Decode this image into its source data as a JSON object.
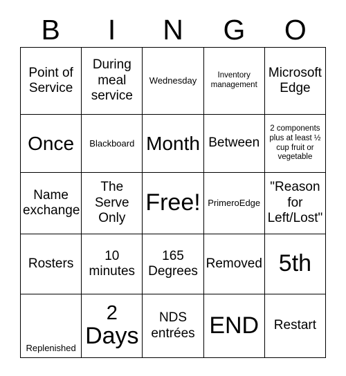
{
  "card": {
    "header_letters": [
      "B",
      "I",
      "N",
      "G",
      "O"
    ],
    "rows": [
      [
        {
          "text": "Point of Service",
          "size": "fs-md"
        },
        {
          "text": "During meal service",
          "size": "fs-md"
        },
        {
          "text": "Wednesday",
          "size": "fs-sm"
        },
        {
          "text": "Inventory management",
          "size": "fs-xs"
        },
        {
          "text": "Microsoft Edge",
          "size": "fs-md"
        }
      ],
      [
        {
          "text": "Once",
          "size": "fs-xl"
        },
        {
          "text": "Blackboard",
          "size": "fs-sm"
        },
        {
          "text": "Month",
          "size": "fs-xl"
        },
        {
          "text": "Between",
          "size": "fs-md"
        },
        {
          "text": "2 components plus at least ½ cup fruit or vegetable",
          "size": "fs-xs"
        }
      ],
      [
        {
          "text": "Name exchange",
          "size": "fs-md"
        },
        {
          "text": "The Serve Only",
          "size": "fs-md"
        },
        {
          "text": "Free!",
          "size": "fs-xxl"
        },
        {
          "text": "PrimeroEdge",
          "size": "fs-sm"
        },
        {
          "text": "\"Reason for Left/Lost\"",
          "size": "fs-md"
        }
      ],
      [
        {
          "text": "Rosters",
          "size": "fs-md"
        },
        {
          "text": "10 minutes",
          "size": "fs-md"
        },
        {
          "text": "165 Degrees",
          "size": "fs-md"
        },
        {
          "text": "Removed",
          "size": "fs-md"
        },
        {
          "text": "5th",
          "size": "fs-xxl"
        }
      ],
      [
        {
          "text": "Replenished",
          "size": "fs-sm"
        },
        {
          "text": "2 Days",
          "size": "fs-xxl"
        },
        {
          "text": "NDS entrées",
          "size": "fs-md"
        },
        {
          "text": "END",
          "size": "fs-xxl"
        },
        {
          "text": "Restart",
          "size": "fs-md"
        }
      ]
    ],
    "free_space_label": "Free!",
    "colors": {
      "background": "#ffffff",
      "text": "#000000",
      "border": "#000000"
    }
  }
}
